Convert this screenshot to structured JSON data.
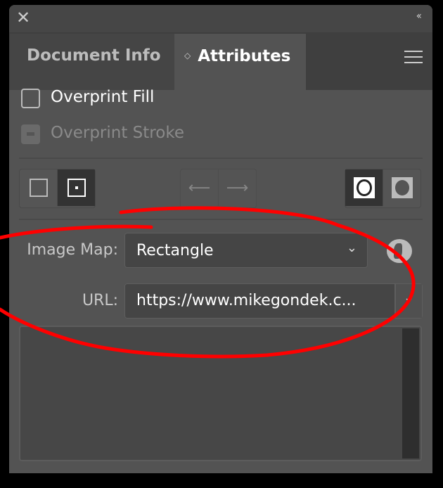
{
  "tabs": [
    {
      "label": "Document Info"
    },
    {
      "label": "Attributes"
    }
  ],
  "overprint_fill": {
    "label": "Overprint Fill",
    "checked": false
  },
  "overprint_stroke": {
    "label": "Overprint Stroke",
    "disabled": true
  },
  "image_map": {
    "label": "Image Map:",
    "value": "Rectangle"
  },
  "url": {
    "label": "URL:",
    "value": "https://www.mikegondek.c..."
  },
  "colors": {
    "panel": "#535353",
    "annotation": "#ff0000"
  }
}
